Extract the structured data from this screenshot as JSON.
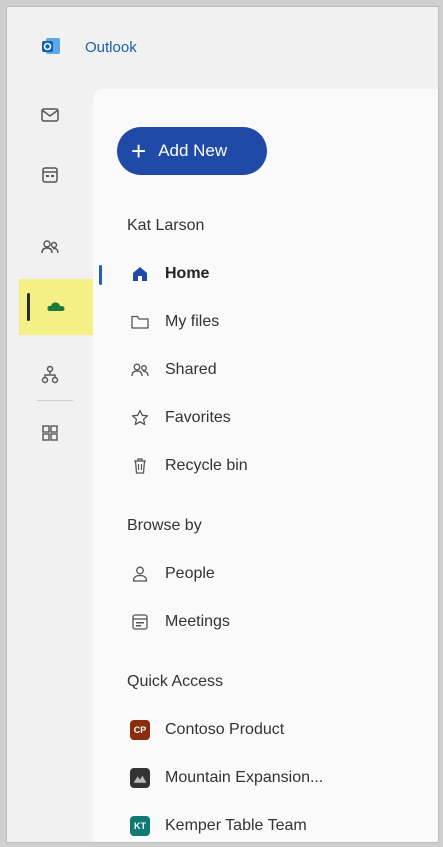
{
  "app": {
    "title": "Outlook",
    "brand_color": "#1a5fb4"
  },
  "rail": {
    "items": [
      {
        "name": "mail-icon"
      },
      {
        "name": "calendar-icon"
      },
      {
        "name": "people-icon"
      },
      {
        "name": "onedrive-cloud-icon",
        "active": true
      },
      {
        "name": "org-chart-icon"
      },
      {
        "name": "apps-grid-icon"
      }
    ],
    "highlight_color": "#f5f085"
  },
  "panel": {
    "add_new_label": "Add New",
    "user_name": "Kat Larson",
    "nav": [
      {
        "label": "Home",
        "icon": "home-icon",
        "selected": true
      },
      {
        "label": "My files",
        "icon": "folder-icon"
      },
      {
        "label": "Shared",
        "icon": "people-icon"
      },
      {
        "label": "Favorites",
        "icon": "star-icon"
      },
      {
        "label": "Recycle bin",
        "icon": "trash-icon"
      }
    ],
    "browse_by": {
      "title": "Browse by",
      "items": [
        {
          "label": "People",
          "icon": "person-icon"
        },
        {
          "label": "Meetings",
          "icon": "meeting-calendar-icon"
        }
      ]
    },
    "quick_access": {
      "title": "Quick Access",
      "items": [
        {
          "label": "Contoso Product",
          "badge": "CP",
          "color": "#8a2c0e"
        },
        {
          "label": "Mountain Expansion...",
          "badge": "",
          "color": "#333333"
        },
        {
          "label": "Kemper Table Team",
          "badge": "KT",
          "color": "#0f7a73"
        }
      ]
    }
  }
}
